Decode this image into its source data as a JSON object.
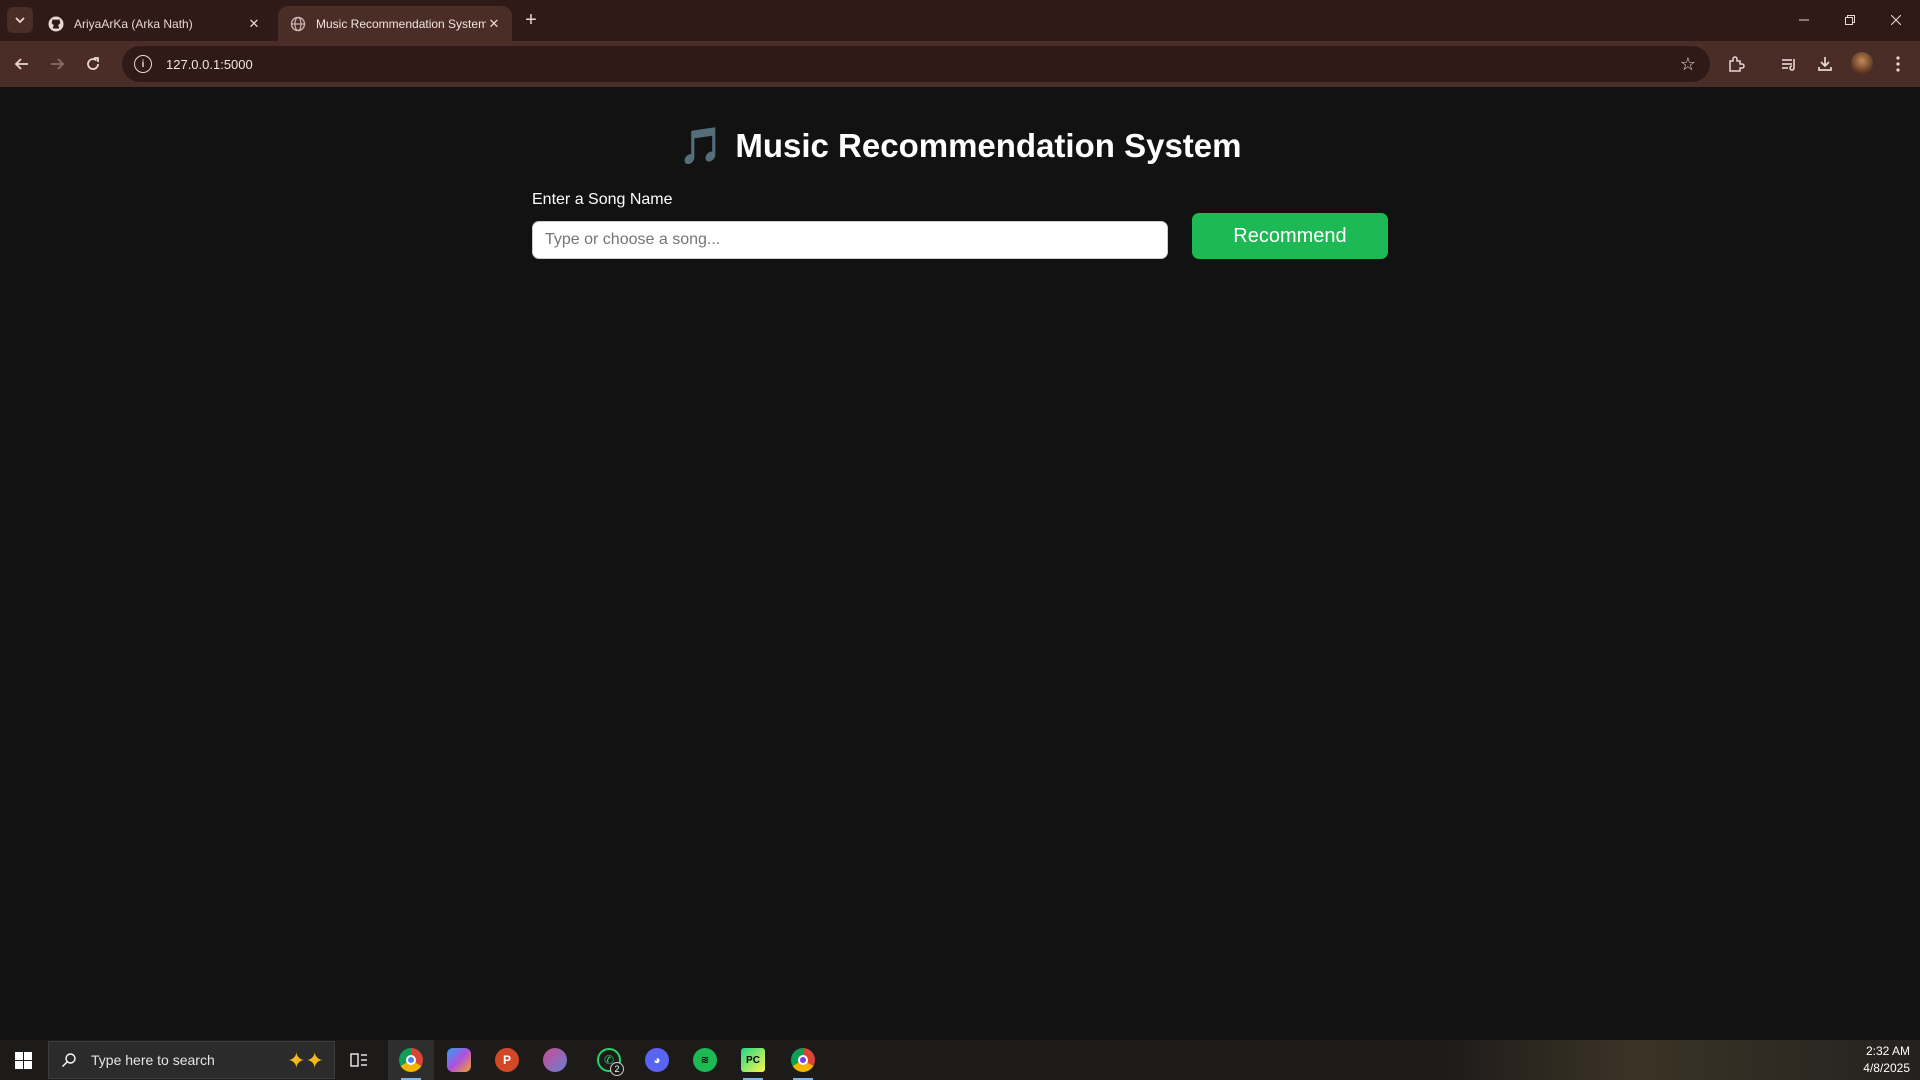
{
  "browser": {
    "tabs": [
      {
        "title": "AriyaArKa (Arka Nath)",
        "favicon": "github-icon",
        "active": false
      },
      {
        "title": "Music Recommendation System",
        "favicon": "globe-icon",
        "active": true
      }
    ],
    "url": "127.0.0.1:5000"
  },
  "page": {
    "heading_icon": "🎵",
    "heading": "Music Recommendation System",
    "label": "Enter a Song Name",
    "input_placeholder": "Type or choose a song...",
    "input_value": "",
    "button_label": "Recommend",
    "accent_color": "#1db954"
  },
  "taskbar": {
    "search_placeholder": "Type here to search",
    "apps": [
      "chrome",
      "copilot",
      "powerpoint",
      "snipping-tool",
      "whatsapp",
      "discord",
      "spotify",
      "pycharm",
      "chrome-profile"
    ],
    "whatsapp_badge": "2",
    "time": "2:32 AM",
    "date": "4/8/2025"
  }
}
